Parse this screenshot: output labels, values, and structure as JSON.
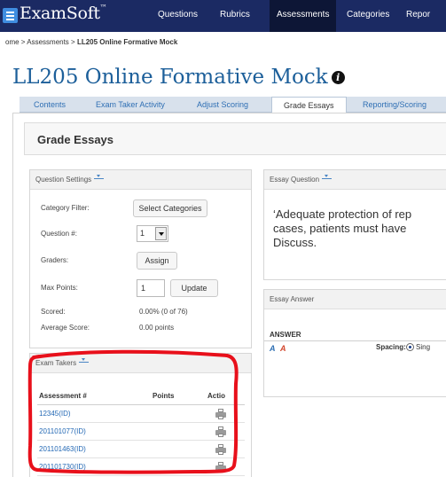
{
  "brand": {
    "logo_text": "ExamSoft",
    "trademark": "™"
  },
  "nav": {
    "questions": "Questions",
    "rubrics": "Rubrics",
    "assessments": "Assessments",
    "categories": "Categories",
    "reporting": "Repor"
  },
  "breadcrumb": {
    "trail": "ome > Assessments > ",
    "current": "LL205 Online Formative Mock"
  },
  "page": {
    "title": "LL205 Online Formative Mock",
    "info_glyph": "i"
  },
  "tabs": {
    "contents": "Contents",
    "exam_taker_activity": "Exam Taker Activity",
    "adjust_scoring": "Adjust Scoring",
    "grade_essays": "Grade Essays",
    "reporting_scoring": "Reporting/Scoring"
  },
  "section": {
    "title": "Grade Essays"
  },
  "question_settings": {
    "title": "Question Settings",
    "category_filter_label": "Category Filter:",
    "select_categories_button": "Select Categories",
    "question_label": "Question #:",
    "question_value": "1",
    "graders_label": "Graders:",
    "assign_button": "Assign",
    "max_points_label": "Max Points:",
    "max_points_value": "1",
    "update_button": "Update",
    "scored_label": "Scored:",
    "scored_value": "0.00% (0 of 76)",
    "average_label": "Average Score:",
    "average_value": "0.00 points"
  },
  "exam_takers": {
    "title": "Exam Takers",
    "columns": {
      "assessment": "Assessment #",
      "points": "Points",
      "actions": "Actio"
    },
    "rows": [
      "12345(ID)",
      "201101077(ID)",
      "201101463(ID)",
      "201101730(ID)"
    ]
  },
  "essay_question": {
    "title": "Essay Question",
    "lines": [
      "‘Adequate protection of rep",
      "cases, patients must have",
      "Discuss."
    ]
  },
  "essay_answer": {
    "title": "Essay Answer",
    "answer_label": "ANSWER",
    "spacing_label": "Spacing:",
    "single_label": "Sing"
  },
  "colors": {
    "nav_background": "#1b2a63",
    "nav_active": "#0d1636",
    "title_blue": "#1c5f9a",
    "link_blue": "#2469b5",
    "annotation_red": "#e8101b"
  }
}
